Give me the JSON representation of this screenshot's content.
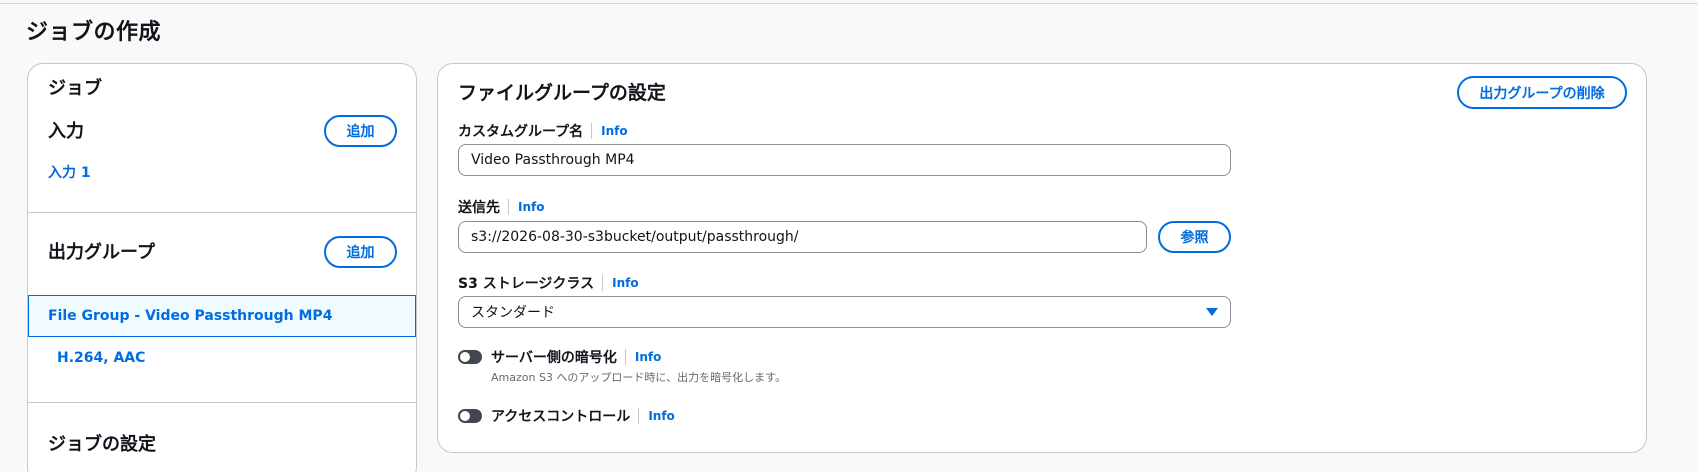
{
  "page": {
    "title": "ジョブの作成"
  },
  "left_panel": {
    "job_heading": "ジョブ",
    "input_heading": "入力",
    "input_add_label": "追加",
    "input_items": [
      "入力 1"
    ],
    "output_group_heading": "出力グループ",
    "output_add_label": "追加",
    "selected_group": "File Group - Video Passthrough MP4",
    "output_items": [
      "H.264, AAC"
    ],
    "job_settings_heading": "ジョブの設定"
  },
  "file_group": {
    "title": "ファイルグループの設定",
    "delete_label": "出力グループの削除",
    "info_label": "Info",
    "custom_name": {
      "label": "カスタムグループ名",
      "value": "Video Passthrough MP4"
    },
    "destination": {
      "label": "送信先",
      "value": "s3://2026-08-30-s3bucket/output/passthrough/",
      "browse_label": "参照"
    },
    "storage_class": {
      "label": "S3 ストレージクラス",
      "selected": "スタンダード"
    },
    "encryption": {
      "label": "サーバー側の暗号化",
      "description": "Amazon S3 へのアップロード時に、出力を暗号化します。",
      "enabled": false
    },
    "access_control": {
      "label": "アクセスコントロール",
      "enabled": false
    }
  }
}
